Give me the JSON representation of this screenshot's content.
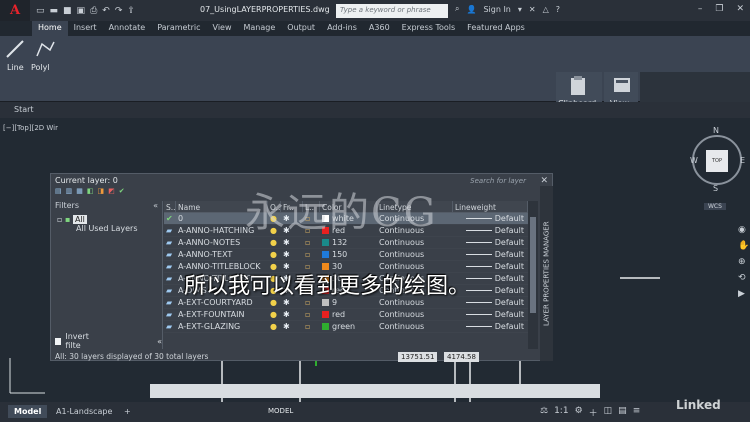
{
  "titlebar": {
    "app_letter": "A",
    "doc_title": "07_UsingLAYERPROPERTIES.dwg",
    "search_placeholder": "Type a keyword or phrase",
    "sign_in": "Sign In"
  },
  "ribbon": {
    "tabs": [
      "Home",
      "Insert",
      "Annotate",
      "Parametric",
      "View",
      "Manage",
      "Output",
      "Add-ins",
      "A360",
      "Express Tools",
      "Featured Apps"
    ],
    "active_tab": "Home",
    "tools": {
      "line": "Line",
      "polyline": "Polyl",
      "clipboard": "Clipboard",
      "view": "View"
    }
  },
  "filetabs": {
    "start": "Start"
  },
  "viewport_label": "[−][Top][2D Wir",
  "layer_palette": {
    "current_layer": "Current layer: 0",
    "search_placeholder": "Search for layer",
    "side_title": "LAYER PROPERTIES MANAGER",
    "filters_title": "Filters",
    "filter_all": "All",
    "filter_used": "All Used Layers",
    "invert_filter": "Invert filte",
    "columns": {
      "status": "S..",
      "name": "Name",
      "on": "O..",
      "freeze": "Fr..",
      "lock": "L..",
      "color": "Color",
      "linetype": "Linetype",
      "lineweight": "Lineweight"
    },
    "rows": [
      {
        "name": "0",
        "color_name": "white",
        "color_hex": "#ffffff",
        "linetype": "Continuous",
        "lineweight": "Default",
        "current": true
      },
      {
        "name": "A-ANNO-HATCHING",
        "color_name": "red",
        "color_hex": "#e82020",
        "linetype": "Continuous",
        "lineweight": "Default",
        "current": false
      },
      {
        "name": "A-ANNO-NOTES",
        "color_name": "132",
        "color_hex": "#1a8a8a",
        "linetype": "Continuous",
        "lineweight": "Default",
        "current": false
      },
      {
        "name": "A-ANNO-TEXT",
        "color_name": "150",
        "color_hex": "#1f7ad8",
        "linetype": "Continuous",
        "lineweight": "Default",
        "current": false
      },
      {
        "name": "A-ANNO-TITLEBLOCK",
        "color_name": "30",
        "color_hex": "#f08a1c",
        "linetype": "Continuous",
        "lineweight": "Default",
        "current": false
      },
      {
        "name": "A-ANNO-TITLETEXT",
        "color_name": "30",
        "color_hex": "#f08a1c",
        "linetype": "Continuous",
        "lineweight": "Default",
        "current": false
      },
      {
        "name": "A-DIMS",
        "color_name": "red",
        "color_hex": "#e82020",
        "linetype": "Continuous",
        "lineweight": "Default",
        "current": false
      },
      {
        "name": "A-EXT-COURTYARD",
        "color_name": "9",
        "color_hex": "#c0c0c0",
        "linetype": "Continuous",
        "lineweight": "Default",
        "current": false
      },
      {
        "name": "A-EXT-FOUNTAIN",
        "color_name": "red",
        "color_hex": "#e82020",
        "linetype": "Continuous",
        "lineweight": "Default",
        "current": false
      },
      {
        "name": "A-EXT-GLAZING",
        "color_name": "green",
        "color_hex": "#2fae2f",
        "linetype": "Continuous",
        "lineweight": "Default",
        "current": false
      }
    ],
    "status_text": "All: 30 layers displayed of 30 total layers"
  },
  "watermark": "永远的CG",
  "viewcube": {
    "n": "N",
    "s": "S",
    "w": "W",
    "e": "E",
    "top": "TOP",
    "wcs": "WCS"
  },
  "coordinates": {
    "x": "13751.51",
    "y": "4174.58"
  },
  "subtitle": "所以我可以看到更多的绘图。",
  "statusbar": {
    "model_tab": "Model",
    "layout_tab": "A1-Landscape",
    "add_tab": "+",
    "model_button": "MODEL",
    "scale": "1:1"
  },
  "brand": "Linked"
}
